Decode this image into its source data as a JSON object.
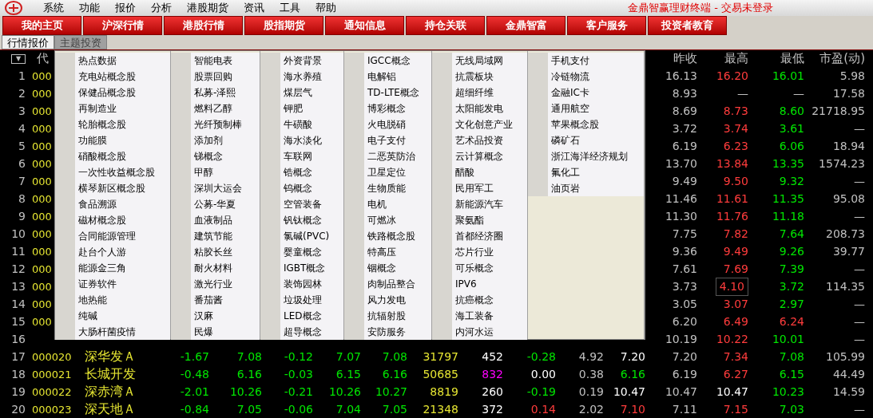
{
  "menu_bar": {
    "items": [
      "系统",
      "功能",
      "报价",
      "分析",
      "港股期货",
      "资讯",
      "工具",
      "帮助"
    ],
    "status": "金鼎智赢理财终端 - 交易未登录"
  },
  "nav_buttons": [
    "我的主页",
    "沪深行情",
    "港股行情",
    "股指期货",
    "通知信息",
    "持仓关联",
    "金鼎智富",
    "客户服务",
    "投资者教育"
  ],
  "tabs": [
    {
      "label": "行情报价",
      "selected": true
    },
    {
      "label": "主题投资",
      "selected": false
    }
  ],
  "table": {
    "menu_glyph": "▼",
    "columns": [
      "代",
      "昨收",
      "最高",
      "最低",
      "市盈(动)"
    ],
    "rows": [
      {
        "num": "1",
        "code": "000",
        "right": [
          {
            "text": "16.13",
            "color": "#c0c0c0"
          },
          {
            "text": "16.20",
            "color": "#ff3c3c"
          },
          {
            "text": "16.01",
            "color": "#00e600"
          },
          {
            "text": "5.98",
            "color": "#c0c0c0"
          }
        ]
      },
      {
        "num": "2",
        "code": "000",
        "right": [
          {
            "text": "8.93",
            "color": "#c0c0c0"
          },
          {
            "text": "—",
            "color": "#c0c0c0"
          },
          {
            "text": "—",
            "color": "#c0c0c0"
          },
          {
            "text": "17.58",
            "color": "#c0c0c0"
          }
        ]
      },
      {
        "num": "3",
        "code": "000",
        "right": [
          {
            "text": "8.69",
            "color": "#c0c0c0"
          },
          {
            "text": "8.73",
            "color": "#ff3c3c"
          },
          {
            "text": "8.60",
            "color": "#00e600"
          },
          {
            "text": "21718.95",
            "color": "#c0c0c0"
          }
        ]
      },
      {
        "num": "4",
        "code": "000",
        "right": [
          {
            "text": "3.72",
            "color": "#c0c0c0"
          },
          {
            "text": "3.74",
            "color": "#ff3c3c"
          },
          {
            "text": "3.61",
            "color": "#00e600"
          },
          {
            "text": "—",
            "color": "#c0c0c0"
          }
        ]
      },
      {
        "num": "5",
        "code": "000",
        "right": [
          {
            "text": "6.19",
            "color": "#c0c0c0"
          },
          {
            "text": "6.23",
            "color": "#ff3c3c"
          },
          {
            "text": "6.06",
            "color": "#00e600"
          },
          {
            "text": "18.94",
            "color": "#c0c0c0"
          }
        ]
      },
      {
        "num": "6",
        "code": "000",
        "right": [
          {
            "text": "13.70",
            "color": "#c0c0c0"
          },
          {
            "text": "13.84",
            "color": "#ff3c3c"
          },
          {
            "text": "13.35",
            "color": "#00e600"
          },
          {
            "text": "1574.23",
            "color": "#c0c0c0"
          }
        ]
      },
      {
        "num": "7",
        "code": "000",
        "right": [
          {
            "text": "9.49",
            "color": "#c0c0c0"
          },
          {
            "text": "9.50",
            "color": "#ff3c3c"
          },
          {
            "text": "9.32",
            "color": "#00e600"
          },
          {
            "text": "—",
            "color": "#c0c0c0"
          }
        ]
      },
      {
        "num": "8",
        "code": "000",
        "right": [
          {
            "text": "11.46",
            "color": "#c0c0c0"
          },
          {
            "text": "11.61",
            "color": "#ff3c3c"
          },
          {
            "text": "11.35",
            "color": "#00e600"
          },
          {
            "text": "95.08",
            "color": "#c0c0c0"
          }
        ]
      },
      {
        "num": "9",
        "code": "000",
        "right": [
          {
            "text": "11.30",
            "color": "#c0c0c0"
          },
          {
            "text": "11.76",
            "color": "#ff3c3c"
          },
          {
            "text": "11.18",
            "color": "#00e600"
          },
          {
            "text": "—",
            "color": "#c0c0c0"
          }
        ]
      },
      {
        "num": "10",
        "code": "000",
        "right": [
          {
            "text": "7.75",
            "color": "#c0c0c0"
          },
          {
            "text": "7.82",
            "color": "#ff3c3c"
          },
          {
            "text": "7.64",
            "color": "#00e600"
          },
          {
            "text": "208.73",
            "color": "#c0c0c0"
          }
        ]
      },
      {
        "num": "11",
        "code": "000",
        "right": [
          {
            "text": "9.36",
            "color": "#c0c0c0"
          },
          {
            "text": "9.49",
            "color": "#ff3c3c"
          },
          {
            "text": "9.26",
            "color": "#00e600"
          },
          {
            "text": "39.77",
            "color": "#c0c0c0"
          }
        ]
      },
      {
        "num": "12",
        "code": "000",
        "right": [
          {
            "text": "7.61",
            "color": "#c0c0c0"
          },
          {
            "text": "7.69",
            "color": "#ff3c3c"
          },
          {
            "text": "7.39",
            "color": "#00e600"
          },
          {
            "text": "—",
            "color": "#c0c0c0"
          }
        ]
      },
      {
        "num": "13",
        "code": "000",
        "right": [
          {
            "text": "3.73",
            "color": "#c0c0c0"
          },
          {
            "text": "4.10",
            "color": "#ff3c3c",
            "boxed": true
          },
          {
            "text": "3.72",
            "color": "#00e600"
          },
          {
            "text": "114.35",
            "color": "#c0c0c0"
          }
        ]
      },
      {
        "num": "14",
        "code": "000",
        "right": [
          {
            "text": "3.05",
            "color": "#c0c0c0"
          },
          {
            "text": "3.07",
            "color": "#ff3c3c"
          },
          {
            "text": "2.97",
            "color": "#00e600"
          },
          {
            "text": "—",
            "color": "#c0c0c0"
          }
        ]
      },
      {
        "num": "15",
        "code": "000",
        "right": [
          {
            "text": "6.20",
            "color": "#c0c0c0"
          },
          {
            "text": "6.49",
            "color": "#ff3c3c"
          },
          {
            "text": "6.24",
            "color": "#ff3c3c"
          },
          {
            "text": "—",
            "color": "#c0c0c0"
          }
        ]
      },
      {
        "num": "16",
        "right": [
          {
            "text": "10.19",
            "color": "#c0c0c0"
          },
          {
            "text": "10.22",
            "color": "#ff3c3c"
          },
          {
            "text": "10.01",
            "color": "#00e600"
          },
          {
            "text": "—",
            "color": "#c0c0c0"
          }
        ]
      },
      {
        "num": "17",
        "code": "000020",
        "name": "深华发Ａ",
        "mid": [
          {
            "text": "-1.67",
            "color": "#00e600"
          },
          {
            "text": "7.08",
            "color": "#00e600"
          },
          {
            "text": "-0.12",
            "color": "#00e600"
          },
          {
            "text": "7.07",
            "color": "#00e600"
          },
          {
            "text": "7.08",
            "color": "#00e600"
          },
          {
            "text": "31797",
            "color": "#e6e632"
          },
          {
            "text": "452",
            "color": "#ffffff"
          },
          {
            "text": "-0.28",
            "color": "#00e600"
          },
          {
            "text": "4.92",
            "color": "#c0c0c0"
          },
          {
            "text": "7.20",
            "color": "#ffffff"
          }
        ],
        "right": [
          {
            "text": "7.20",
            "color": "#c0c0c0"
          },
          {
            "text": "7.34",
            "color": "#ff3c3c"
          },
          {
            "text": "7.08",
            "color": "#00e600"
          },
          {
            "text": "105.99",
            "color": "#c0c0c0"
          }
        ]
      },
      {
        "num": "18",
        "code": "000021",
        "name": "长城开发",
        "mid": [
          {
            "text": "-0.48",
            "color": "#00e600"
          },
          {
            "text": "6.16",
            "color": "#00e600"
          },
          {
            "text": "-0.03",
            "color": "#00e600"
          },
          {
            "text": "6.15",
            "color": "#00e600"
          },
          {
            "text": "6.16",
            "color": "#00e600"
          },
          {
            "text": "50685",
            "color": "#e6e632"
          },
          {
            "text": "832",
            "color": "#ff00ff"
          },
          {
            "text": "0.00",
            "color": "#ffffff"
          },
          {
            "text": "0.38",
            "color": "#c0c0c0"
          },
          {
            "text": "6.16",
            "color": "#00e600"
          }
        ],
        "right": [
          {
            "text": "6.19",
            "color": "#c0c0c0"
          },
          {
            "text": "6.27",
            "color": "#ff3c3c"
          },
          {
            "text": "6.15",
            "color": "#00e600"
          },
          {
            "text": "44.49",
            "color": "#c0c0c0"
          }
        ]
      },
      {
        "num": "19",
        "code": "000022",
        "name": "深赤湾Ａ",
        "mid": [
          {
            "text": "-2.01",
            "color": "#00e600"
          },
          {
            "text": "10.26",
            "color": "#00e600"
          },
          {
            "text": "-0.21",
            "color": "#00e600"
          },
          {
            "text": "10.26",
            "color": "#00e600"
          },
          {
            "text": "10.27",
            "color": "#00e600"
          },
          {
            "text": "8819",
            "color": "#e6e632"
          },
          {
            "text": "260",
            "color": "#ffffff"
          },
          {
            "text": "-0.19",
            "color": "#00e600"
          },
          {
            "text": "0.19",
            "color": "#c0c0c0"
          },
          {
            "text": "10.47",
            "color": "#ffffff"
          }
        ],
        "right": [
          {
            "text": "10.47",
            "color": "#c0c0c0"
          },
          {
            "text": "10.47",
            "color": "#ffffff"
          },
          {
            "text": "10.23",
            "color": "#00e600"
          },
          {
            "text": "14.59",
            "color": "#c0c0c0"
          }
        ]
      },
      {
        "num": "20",
        "code": "000023",
        "name": "深天地Ａ",
        "mid": [
          {
            "text": "-0.84",
            "color": "#00e600"
          },
          {
            "text": "7.05",
            "color": "#00e600"
          },
          {
            "text": "-0.06",
            "color": "#00e600"
          },
          {
            "text": "7.04",
            "color": "#00e600"
          },
          {
            "text": "7.05",
            "color": "#00e600"
          },
          {
            "text": "21348",
            "color": "#e6e632"
          },
          {
            "text": "372",
            "color": "#ffffff"
          },
          {
            "text": "0.14",
            "color": "#ff3c3c"
          },
          {
            "text": "2.02",
            "color": "#c0c0c0"
          },
          {
            "text": "7.10",
            "color": "#ff3c3c"
          }
        ],
        "right": [
          {
            "text": "7.11",
            "color": "#c0c0c0"
          },
          {
            "text": "7.15",
            "color": "#ff3c3c"
          },
          {
            "text": "7.03",
            "color": "#00e600"
          },
          {
            "text": "—",
            "color": "#c0c0c0"
          }
        ]
      }
    ]
  },
  "theme_menu": {
    "columns": [
      {
        "items": [
          "热点数据",
          "充电站概念股",
          "保健品概念股",
          "再制造业",
          "轮胎概念股",
          "功能膜",
          "硝酸概念股",
          "一次性收益概念股",
          "横琴新区概念股",
          "食品溯源",
          "磁材概念股",
          "合同能源管理",
          "赴台个人游",
          "能源金三角",
          "证券软件",
          "地热能",
          "纯碱",
          "大肠杆菌疫情"
        ]
      },
      {
        "items": [
          "智能电表",
          "股票回购",
          "私募-泽熙",
          "燃料乙醇",
          "光纤预制棒",
          "添加剂",
          "锑概念",
          "甲醇",
          "深圳大运会",
          "公募-华夏",
          "血液制品",
          "建筑节能",
          "粘胶长丝",
          "耐火材料",
          "激光行业",
          "番茄酱",
          "汉麻",
          "民爆"
        ]
      },
      {
        "items": [
          "外资背景",
          "海水养殖",
          "煤层气",
          "钾肥",
          "牛磺酸",
          "海水淡化",
          "车联网",
          "锆概念",
          "钨概念",
          "空管装备",
          "钒钛概念",
          "氯碱(PVC)",
          "婴童概念",
          "IGBT概念",
          "装饰园林",
          "垃圾处理",
          "LED概念",
          "超导概念"
        ]
      },
      {
        "items": [
          "IGCC概念",
          "电解铝",
          "TD-LTE概念",
          "博彩概念",
          "火电脱硝",
          "电子支付",
          "二恶英防治",
          "卫星定位",
          "生物质能",
          "电机",
          "可燃冰",
          "铁路概念股",
          "特高压",
          "铟概念",
          "肉制品整合",
          "风力发电",
          "抗辐射股",
          "安防服务"
        ]
      },
      {
        "items": [
          "无线局域网",
          "抗震板块",
          "超细纤维",
          "太阳能发电",
          "文化创意产业",
          "艺术品投资",
          "云计算概念",
          "醋酸",
          "民用军工",
          "新能源汽车",
          "聚氨酯",
          "首都经济圈",
          "芯片行业",
          "可乐概念",
          "IPV6",
          "抗癌概念",
          "海工装备",
          "内河水运"
        ]
      },
      {
        "items": [
          "手机支付",
          "冷链物流",
          "金融IC卡",
          "通用航空",
          "苹果概念股",
          "磷矿石",
          "浙江海洋经济规划",
          "氟化工",
          "油页岩"
        ]
      }
    ]
  }
}
